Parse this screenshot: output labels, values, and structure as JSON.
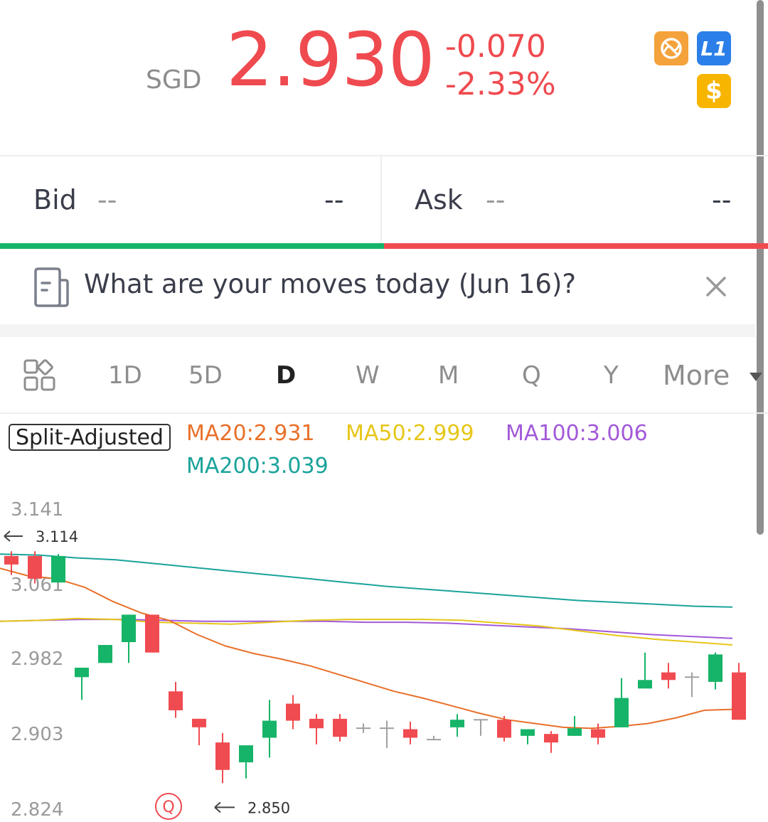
{
  "quote": {
    "currency": "SGD",
    "price": "2.930",
    "change": "-0.070",
    "change_pct": "-2.33%",
    "badges": {
      "orange": "no-trade-icon",
      "blue_label": "L1",
      "yellow_label": "$"
    }
  },
  "bid": {
    "label": "Bid",
    "price": "--",
    "volume": "--"
  },
  "ask": {
    "label": "Ask",
    "price": "--",
    "volume": "--"
  },
  "banner": {
    "text": "What are your moves today (Jun 16)?"
  },
  "tabs": [
    "1D",
    "5D",
    "D",
    "W",
    "M",
    "Q",
    "Y",
    "More"
  ],
  "active_tab": "D",
  "indicators": {
    "split_label": "Split-Adjusted",
    "ma20": "MA20:2.931",
    "ma50": "MA50:2.999",
    "ma100": "MA100:3.006",
    "ma200": "MA200:3.039"
  },
  "colors": {
    "up": "#16b468",
    "down": "#f04b50",
    "flat": "#a0a0a0",
    "ma20": "#e8702a",
    "ma50": "#e6c619",
    "ma100": "#a259d9",
    "ma200": "#1aa39a"
  },
  "chart_data": {
    "type": "candlestick",
    "y_ticks": [
      "3.141",
      "3.061",
      "2.982",
      "2.903",
      "2.824"
    ],
    "ylim": [
      2.818,
      3.15
    ],
    "high_marker": "3.114",
    "low_marker": "2.850",
    "event_marker": "Q",
    "candles": [
      {
        "o": 3.093,
        "h": 3.098,
        "c": 3.084,
        "l": 3.073
      },
      {
        "o": 3.093,
        "h": 3.098,
        "c": 3.069,
        "l": 3.064
      },
      {
        "o": 3.065,
        "h": 3.095,
        "c": 3.093,
        "l": 3.065
      },
      {
        "o": 2.965,
        "h": 2.968,
        "c": 2.975,
        "l": 2.941
      },
      {
        "o": 2.98,
        "h": 2.999,
        "c": 2.999,
        "l": 2.98
      },
      {
        "o": 3.002,
        "h": 3.031,
        "c": 3.031,
        "l": 2.98
      },
      {
        "o": 3.031,
        "h": 3.031,
        "c": 2.991,
        "l": 2.991
      },
      {
        "o": 2.95,
        "h": 2.96,
        "c": 2.93,
        "l": 2.922
      },
      {
        "o": 2.921,
        "h": 2.921,
        "c": 2.912,
        "l": 2.893
      },
      {
        "o": 2.896,
        "h": 2.906,
        "c": 2.867,
        "l": 2.853
      },
      {
        "o": 2.875,
        "h": 2.89,
        "c": 2.893,
        "l": 2.858
      },
      {
        "o": 2.901,
        "h": 2.941,
        "c": 2.919,
        "l": 2.88
      },
      {
        "o": 2.937,
        "h": 2.946,
        "c": 2.919,
        "l": 2.91
      },
      {
        "o": 2.921,
        "h": 2.926,
        "c": 2.911,
        "l": 2.894
      },
      {
        "o": 2.921,
        "h": 2.926,
        "c": 2.902,
        "l": 2.897
      },
      {
        "o": 2.911,
        "h": 2.916,
        "c": 2.911,
        "l": 2.906
      },
      {
        "o": 2.911,
        "h": 2.919,
        "c": 2.911,
        "l": 2.89
      },
      {
        "o": 2.91,
        "h": 2.918,
        "c": 2.901,
        "l": 2.894
      },
      {
        "o": 2.899,
        "h": 2.903,
        "c": 2.899,
        "l": 2.899
      },
      {
        "o": 2.912,
        "h": 2.926,
        "c": 2.92,
        "l": 2.902
      },
      {
        "o": 2.92,
        "h": 2.92,
        "c": 2.92,
        "l": 2.903
      },
      {
        "o": 2.92,
        "h": 2.924,
        "c": 2.901,
        "l": 2.897
      },
      {
        "o": 2.903,
        "h": 2.91,
        "c": 2.91,
        "l": 2.894
      },
      {
        "o": 2.905,
        "h": 2.908,
        "c": 2.896,
        "l": 2.885
      },
      {
        "o": 2.903,
        "h": 2.924,
        "c": 2.911,
        "l": 2.903
      },
      {
        "o": 2.91,
        "h": 2.916,
        "c": 2.901,
        "l": 2.894
      },
      {
        "o": 2.912,
        "h": 2.964,
        "c": 2.943,
        "l": 2.912
      },
      {
        "o": 2.953,
        "h": 2.991,
        "c": 2.962,
        "l": 2.953
      },
      {
        "o": 2.97,
        "h": 2.98,
        "c": 2.962,
        "l": 2.953
      },
      {
        "o": 2.965,
        "h": 2.97,
        "c": 2.965,
        "l": 2.944
      },
      {
        "o": 2.96,
        "h": 2.991,
        "c": 2.989,
        "l": 2.952
      },
      {
        "o": 2.97,
        "h": 2.98,
        "c": 2.92,
        "l": 2.92
      }
    ],
    "ma20": [
      3.08,
      3.072,
      3.069,
      3.06,
      3.045,
      3.033,
      3.025,
      3.01,
      2.998,
      2.99,
      2.984,
      2.977,
      2.968,
      2.959,
      2.95,
      2.943,
      2.935,
      2.927,
      2.92,
      2.916,
      2.912,
      2.911,
      2.913,
      2.916,
      2.922,
      2.93,
      2.931
    ],
    "ma50": [
      3.024,
      3.025,
      3.027,
      3.026,
      3.023,
      3.022,
      3.021,
      3.023,
      3.025,
      3.026,
      3.026,
      3.026,
      3.025,
      3.022,
      3.019,
      3.014,
      3.009,
      3.005,
      3.002,
      2.999
    ],
    "ma100": [
      3.024,
      3.025,
      3.026,
      3.026,
      3.025,
      3.024,
      3.024,
      3.024,
      3.024,
      3.023,
      3.023,
      3.022,
      3.02,
      3.018,
      3.016,
      3.013,
      3.01,
      3.008,
      3.006
    ],
    "ma200": [
      3.095,
      3.094,
      3.091,
      3.089,
      3.085,
      3.081,
      3.077,
      3.073,
      3.069,
      3.065,
      3.061,
      3.058,
      3.055,
      3.052,
      3.049,
      3.046,
      3.044,
      3.042,
      3.04,
      3.039
    ]
  }
}
